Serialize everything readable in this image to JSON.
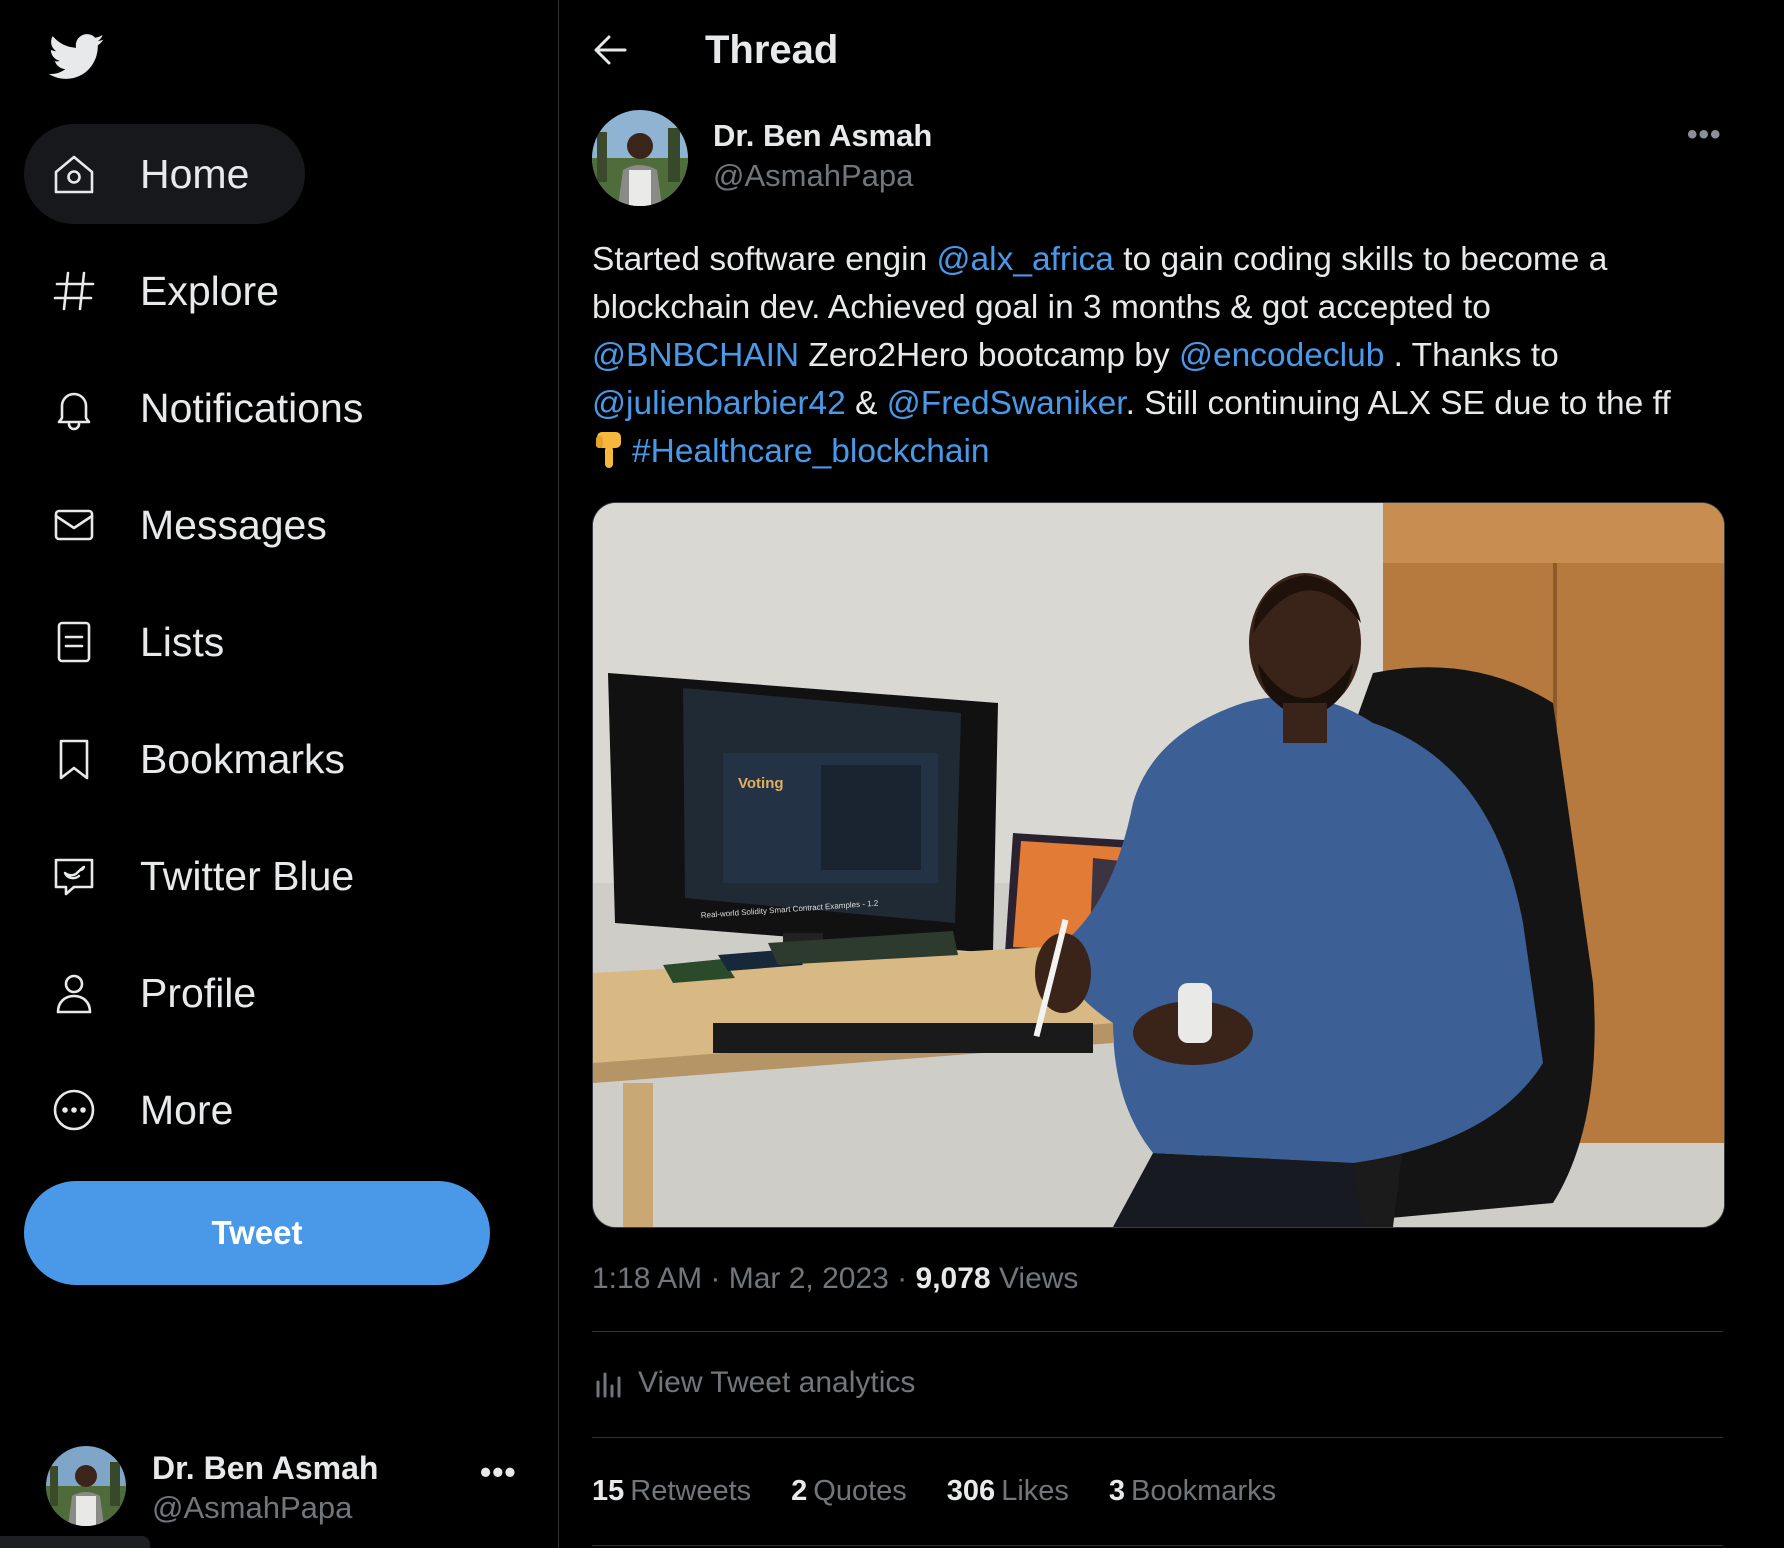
{
  "sidebar": {
    "logo": "twitter-bird-icon",
    "nav": [
      {
        "label": "Home",
        "icon": "home-icon",
        "active": true
      },
      {
        "label": "Explore",
        "icon": "hashtag-icon"
      },
      {
        "label": "Notifications",
        "icon": "bell-icon"
      },
      {
        "label": "Messages",
        "icon": "envelope-icon"
      },
      {
        "label": "Lists",
        "icon": "list-icon"
      },
      {
        "label": "Bookmarks",
        "icon": "bookmark-icon"
      },
      {
        "label": "Twitter Blue",
        "icon": "twitter-blue-icon"
      },
      {
        "label": "Profile",
        "icon": "person-icon"
      },
      {
        "label": "More",
        "icon": "more-circle-icon"
      }
    ],
    "tweet_button": "Tweet",
    "account": {
      "name": "Dr. Ben Asmah",
      "handle": "@AsmahPapa",
      "more": "•••"
    }
  },
  "header": {
    "title": "Thread",
    "back_icon": "back-arrow-icon"
  },
  "tweet": {
    "author_name": "Dr. Ben Asmah",
    "author_handle": "@AsmahPapa",
    "more": "•••",
    "text": {
      "l1_a": "Started software engin ",
      "l1_m1": "@alx_africa",
      "l1_b": " to gain coding skills to become a",
      "l2": "blockchain dev. Achieved goal in 3 months & got accepted to",
      "l3_m1": "@BNBCHAIN",
      "l3_a": " Zero2Hero bootcamp by ",
      "l3_m2": "@encodeclub",
      "l3_b": " . Thanks to",
      "l4_m1": "@julienbarbier42",
      "l4_a": " & ",
      "l4_m2": "@FredSwaniker",
      "l4_b": ". Still continuing ALX SE due to the ff",
      "l5_emoji": "pointing-down-emoji",
      "l5_tag": "#Healthcare_blockchain"
    },
    "media": {
      "screen_title": "Voting",
      "screen_caption": "Real-world Solidity Smart Contract Examples - 1.2"
    },
    "time": "1:18 AM",
    "sep1": " · ",
    "date": "Mar 2, 2023",
    "sep2": " · ",
    "views_count": "9,078",
    "views_label": "Views",
    "analytics_label": "View Tweet analytics",
    "stats": {
      "retweets_count": "15",
      "retweets_label": "Retweets",
      "quotes_count": "2",
      "quotes_label": "Quotes",
      "likes_count": "306",
      "likes_label": "Likes",
      "bookmarks_count": "3",
      "bookmarks_label": "Bookmarks"
    }
  },
  "colors": {
    "accent": "#4a99e9",
    "background": "#000000",
    "muted": "#71767b",
    "text": "#e7e9ea",
    "divider": "#2f3336"
  }
}
